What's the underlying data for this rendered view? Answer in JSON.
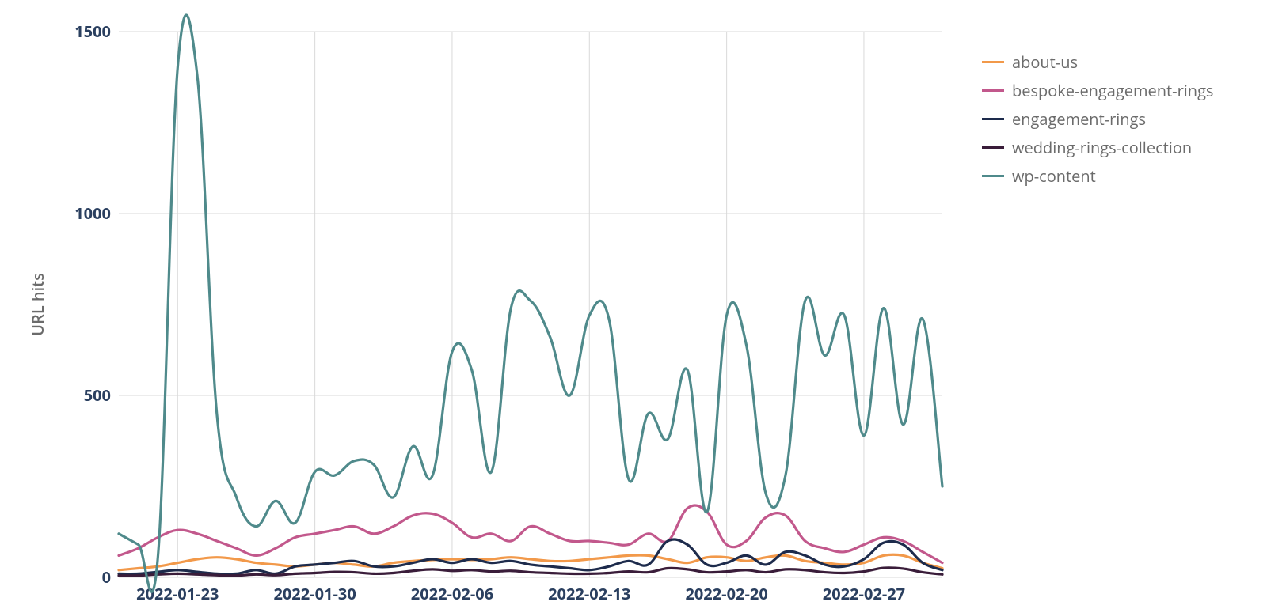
{
  "chart_data": {
    "type": "line",
    "ylabel": "URL hits",
    "xlabel": "",
    "ylim": [
      0,
      1500
    ],
    "x_tick_labels": [
      "2022-01-23",
      "2022-01-30",
      "2022-02-06",
      "2022-02-13",
      "2022-02-20",
      "2022-02-27"
    ],
    "x_tick_indices": [
      3,
      10,
      17,
      24,
      31,
      38
    ],
    "y_ticks": [
      0,
      500,
      1000,
      1500
    ],
    "x": [
      0,
      1,
      2,
      3,
      4,
      5,
      6,
      7,
      8,
      9,
      10,
      11,
      12,
      13,
      14,
      15,
      16,
      17,
      18,
      19,
      20,
      21,
      22,
      23,
      24,
      25,
      26,
      27,
      28,
      29,
      30,
      31,
      32,
      33,
      34,
      35,
      36,
      37,
      38,
      39,
      40,
      41,
      42
    ],
    "series": [
      {
        "name": "about-us",
        "color": "#f2994a",
        "values": [
          20,
          25,
          30,
          40,
          50,
          55,
          50,
          40,
          35,
          30,
          35,
          40,
          35,
          30,
          40,
          45,
          48,
          50,
          48,
          50,
          55,
          50,
          45,
          45,
          50,
          55,
          60,
          60,
          50,
          40,
          55,
          55,
          45,
          55,
          60,
          45,
          40,
          35,
          40,
          60,
          60,
          40,
          25
        ]
      },
      {
        "name": "bespoke-engagement-rings",
        "color": "#c2588c",
        "values": [
          60,
          80,
          110,
          130,
          120,
          100,
          80,
          60,
          80,
          110,
          120,
          130,
          140,
          120,
          140,
          170,
          175,
          150,
          110,
          120,
          100,
          140,
          120,
          100,
          100,
          95,
          90,
          120,
          100,
          190,
          180,
          90,
          100,
          165,
          170,
          100,
          80,
          70,
          90,
          110,
          100,
          70,
          40
        ]
      },
      {
        "name": "engagement-rings",
        "color": "#1d2b4c",
        "values": [
          10,
          10,
          15,
          20,
          15,
          10,
          10,
          20,
          10,
          30,
          35,
          40,
          45,
          30,
          30,
          40,
          50,
          40,
          50,
          40,
          45,
          35,
          30,
          25,
          20,
          30,
          45,
          35,
          100,
          90,
          35,
          40,
          60,
          35,
          70,
          60,
          35,
          30,
          50,
          95,
          90,
          40,
          20
        ]
      },
      {
        "name": "wedding-rings-collection",
        "color": "#3a1d3a",
        "values": [
          5,
          5,
          8,
          10,
          8,
          6,
          5,
          8,
          6,
          10,
          12,
          15,
          14,
          10,
          12,
          18,
          22,
          18,
          20,
          16,
          18,
          14,
          12,
          10,
          10,
          12,
          16,
          14,
          25,
          22,
          14,
          16,
          20,
          14,
          22,
          20,
          14,
          12,
          16,
          26,
          24,
          14,
          8
        ]
      },
      {
        "name": "wp-content",
        "color": "#4f8a8b",
        "values": [
          120,
          90,
          60,
          1400,
          1380,
          450,
          220,
          140,
          210,
          150,
          290,
          280,
          320,
          310,
          220,
          360,
          280,
          620,
          570,
          290,
          740,
          760,
          660,
          500,
          720,
          710,
          270,
          450,
          380,
          570,
          180,
          720,
          640,
          230,
          280,
          760,
          610,
          720,
          390,
          740,
          420,
          710,
          250
        ]
      }
    ]
  }
}
